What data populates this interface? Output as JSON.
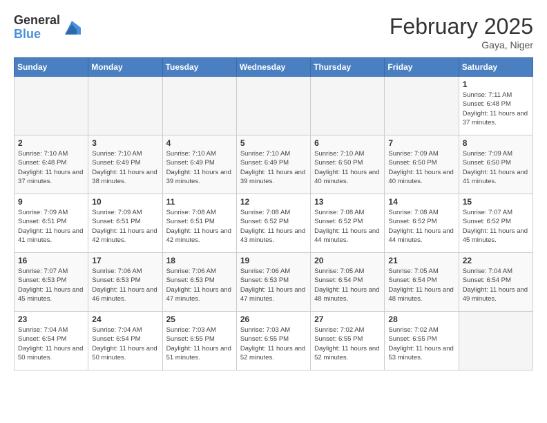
{
  "logo": {
    "general": "General",
    "blue": "Blue"
  },
  "title": "February 2025",
  "location": "Gaya, Niger",
  "days_of_week": [
    "Sunday",
    "Monday",
    "Tuesday",
    "Wednesday",
    "Thursday",
    "Friday",
    "Saturday"
  ],
  "weeks": [
    [
      {
        "day": "",
        "empty": true
      },
      {
        "day": "",
        "empty": true
      },
      {
        "day": "",
        "empty": true
      },
      {
        "day": "",
        "empty": true
      },
      {
        "day": "",
        "empty": true
      },
      {
        "day": "",
        "empty": true
      },
      {
        "day": "1",
        "sunrise": "7:11 AM",
        "sunset": "6:48 PM",
        "daylight": "11 hours and 37 minutes."
      }
    ],
    [
      {
        "day": "2",
        "sunrise": "7:10 AM",
        "sunset": "6:48 PM",
        "daylight": "11 hours and 37 minutes."
      },
      {
        "day": "3",
        "sunrise": "7:10 AM",
        "sunset": "6:49 PM",
        "daylight": "11 hours and 38 minutes."
      },
      {
        "day": "4",
        "sunrise": "7:10 AM",
        "sunset": "6:49 PM",
        "daylight": "11 hours and 39 minutes."
      },
      {
        "day": "5",
        "sunrise": "7:10 AM",
        "sunset": "6:49 PM",
        "daylight": "11 hours and 39 minutes."
      },
      {
        "day": "6",
        "sunrise": "7:10 AM",
        "sunset": "6:50 PM",
        "daylight": "11 hours and 40 minutes."
      },
      {
        "day": "7",
        "sunrise": "7:09 AM",
        "sunset": "6:50 PM",
        "daylight": "11 hours and 40 minutes."
      },
      {
        "day": "8",
        "sunrise": "7:09 AM",
        "sunset": "6:50 PM",
        "daylight": "11 hours and 41 minutes."
      }
    ],
    [
      {
        "day": "9",
        "sunrise": "7:09 AM",
        "sunset": "6:51 PM",
        "daylight": "11 hours and 41 minutes."
      },
      {
        "day": "10",
        "sunrise": "7:09 AM",
        "sunset": "6:51 PM",
        "daylight": "11 hours and 42 minutes."
      },
      {
        "day": "11",
        "sunrise": "7:08 AM",
        "sunset": "6:51 PM",
        "daylight": "11 hours and 42 minutes."
      },
      {
        "day": "12",
        "sunrise": "7:08 AM",
        "sunset": "6:52 PM",
        "daylight": "11 hours and 43 minutes."
      },
      {
        "day": "13",
        "sunrise": "7:08 AM",
        "sunset": "6:52 PM",
        "daylight": "11 hours and 44 minutes."
      },
      {
        "day": "14",
        "sunrise": "7:08 AM",
        "sunset": "6:52 PM",
        "daylight": "11 hours and 44 minutes."
      },
      {
        "day": "15",
        "sunrise": "7:07 AM",
        "sunset": "6:52 PM",
        "daylight": "11 hours and 45 minutes."
      }
    ],
    [
      {
        "day": "16",
        "sunrise": "7:07 AM",
        "sunset": "6:53 PM",
        "daylight": "11 hours and 45 minutes."
      },
      {
        "day": "17",
        "sunrise": "7:06 AM",
        "sunset": "6:53 PM",
        "daylight": "11 hours and 46 minutes."
      },
      {
        "day": "18",
        "sunrise": "7:06 AM",
        "sunset": "6:53 PM",
        "daylight": "11 hours and 47 minutes."
      },
      {
        "day": "19",
        "sunrise": "7:06 AM",
        "sunset": "6:53 PM",
        "daylight": "11 hours and 47 minutes."
      },
      {
        "day": "20",
        "sunrise": "7:05 AM",
        "sunset": "6:54 PM",
        "daylight": "11 hours and 48 minutes."
      },
      {
        "day": "21",
        "sunrise": "7:05 AM",
        "sunset": "6:54 PM",
        "daylight": "11 hours and 48 minutes."
      },
      {
        "day": "22",
        "sunrise": "7:04 AM",
        "sunset": "6:54 PM",
        "daylight": "11 hours and 49 minutes."
      }
    ],
    [
      {
        "day": "23",
        "sunrise": "7:04 AM",
        "sunset": "6:54 PM",
        "daylight": "11 hours and 50 minutes."
      },
      {
        "day": "24",
        "sunrise": "7:04 AM",
        "sunset": "6:54 PM",
        "daylight": "11 hours and 50 minutes."
      },
      {
        "day": "25",
        "sunrise": "7:03 AM",
        "sunset": "6:55 PM",
        "daylight": "11 hours and 51 minutes."
      },
      {
        "day": "26",
        "sunrise": "7:03 AM",
        "sunset": "6:55 PM",
        "daylight": "11 hours and 52 minutes."
      },
      {
        "day": "27",
        "sunrise": "7:02 AM",
        "sunset": "6:55 PM",
        "daylight": "11 hours and 52 minutes."
      },
      {
        "day": "28",
        "sunrise": "7:02 AM",
        "sunset": "6:55 PM",
        "daylight": "11 hours and 53 minutes."
      },
      {
        "day": "",
        "empty": true
      }
    ]
  ]
}
